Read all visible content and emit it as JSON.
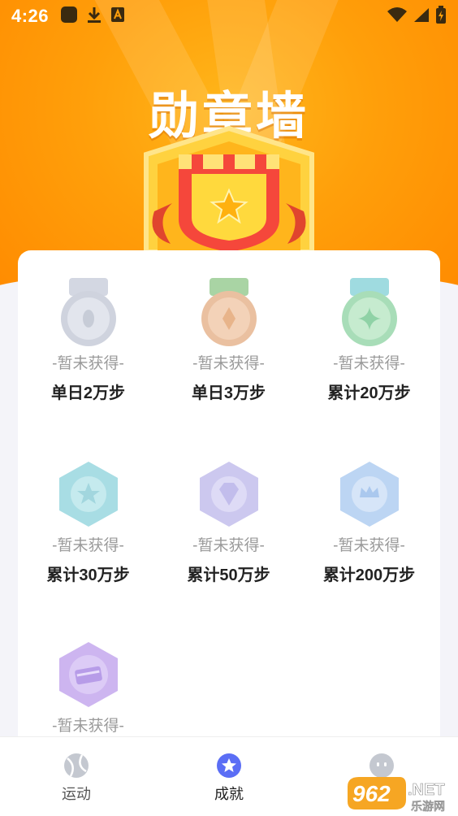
{
  "statusbar": {
    "time": "4:26"
  },
  "hero": {
    "title": "勋章墙"
  },
  "medals": [
    {
      "status": "-暂未获得-",
      "name": "单日2万步",
      "icon": "silver-ribbon-medal-icon",
      "color": "#c9ced9"
    },
    {
      "status": "-暂未获得-",
      "name": "单日3万步",
      "icon": "bronze-ribbon-medal-icon",
      "color": "#e9b58b"
    },
    {
      "status": "-暂未获得-",
      "name": "累计20万步",
      "icon": "green-ribbon-medal-icon",
      "color": "#9fdcb3"
    },
    {
      "status": "-暂未获得-",
      "name": "累计30万步",
      "icon": "teal-star-hexagon-medal-icon",
      "color": "#a7dde3"
    },
    {
      "status": "-暂未获得-",
      "name": "累计50万步",
      "icon": "purple-diamond-hexagon-medal-icon",
      "color": "#c9c4ef"
    },
    {
      "status": "-暂未获得-",
      "name": "累计200万步",
      "icon": "blue-crown-hexagon-medal-icon",
      "color": "#b9d3f3"
    },
    {
      "status": "-暂未获得-",
      "name": "",
      "icon": "violet-card-hexagon-medal-icon",
      "color": "#c9b2ef"
    }
  ],
  "tabbar": {
    "tabs": [
      {
        "label": "运动",
        "icon": "ball-icon"
      },
      {
        "label": "成就",
        "icon": "star-badge-icon"
      },
      {
        "label": "",
        "icon": "profile-face-icon"
      }
    ]
  },
  "watermark": {
    "number": "962",
    "suffix": ".NET",
    "sub": "乐游网"
  }
}
